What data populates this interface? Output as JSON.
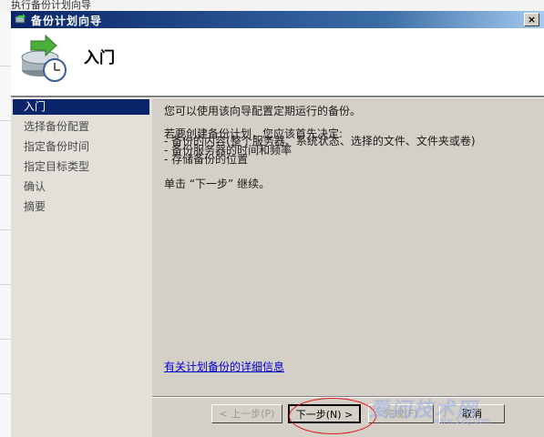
{
  "background": {
    "strip_text": "执行备份计划向导"
  },
  "dialog": {
    "title": "备份计划向导",
    "close_label": "×",
    "header_title": "入门",
    "nav": [
      {
        "label": "入门",
        "active": true
      },
      {
        "label": "选择备份配置",
        "active": false
      },
      {
        "label": "指定备份时间",
        "active": false
      },
      {
        "label": "指定目标类型",
        "active": false
      },
      {
        "label": "确认",
        "active": false
      },
      {
        "label": "摘要",
        "active": false
      }
    ],
    "content": {
      "intro": "您可以使用该向导配置定期运行的备份。",
      "prereq_heading": "若要创建备份计划，您应该首先决定:",
      "bullets": [
        "- 备份的内容(整个服务器、系统状态、选择的文件、文件夹或卷)",
        "- 备份服务器的时间和频率",
        "- 存储备份的位置"
      ],
      "continue_text": "单击 “下一步” 继续。",
      "help_link": "有关计划备份的详细信息"
    },
    "buttons": {
      "prev": "< 上一步(P)",
      "next": "下一步(N) >",
      "finish": "完成(F)",
      "cancel": "取消"
    }
  },
  "watermark": {
    "text": "爱问技术网",
    "url": "www.52tj.com"
  },
  "colors": {
    "title_start": "#0a246a",
    "title_end": "#a6caf0",
    "nav_active": "#0a246a",
    "link": "#0000cc",
    "annotation": "#e01818"
  }
}
